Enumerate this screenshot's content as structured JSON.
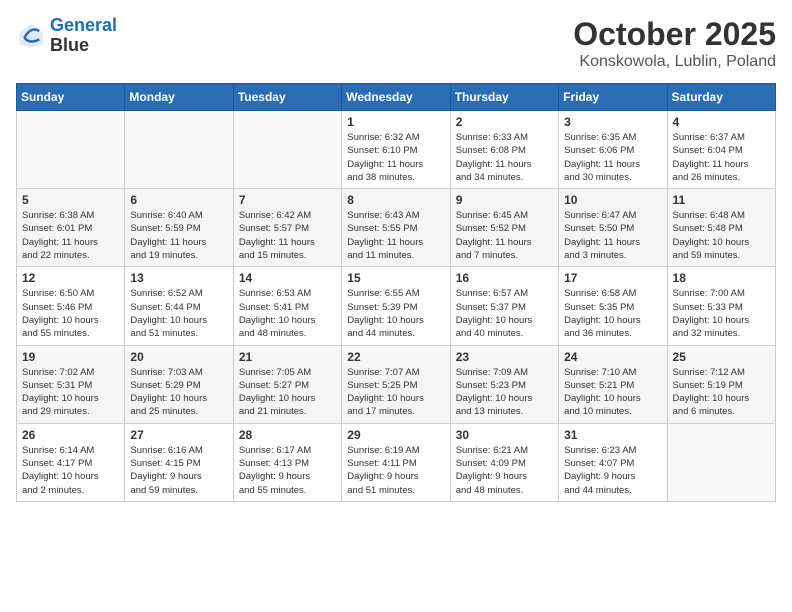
{
  "logo": {
    "line1": "General",
    "line2": "Blue"
  },
  "title": "October 2025",
  "location": "Konskowola, Lublin, Poland",
  "weekdays": [
    "Sunday",
    "Monday",
    "Tuesday",
    "Wednesday",
    "Thursday",
    "Friday",
    "Saturday"
  ],
  "weeks": [
    [
      {
        "day": "",
        "info": ""
      },
      {
        "day": "",
        "info": ""
      },
      {
        "day": "",
        "info": ""
      },
      {
        "day": "1",
        "info": "Sunrise: 6:32 AM\nSunset: 6:10 PM\nDaylight: 11 hours\nand 38 minutes."
      },
      {
        "day": "2",
        "info": "Sunrise: 6:33 AM\nSunset: 6:08 PM\nDaylight: 11 hours\nand 34 minutes."
      },
      {
        "day": "3",
        "info": "Sunrise: 6:35 AM\nSunset: 6:06 PM\nDaylight: 11 hours\nand 30 minutes."
      },
      {
        "day": "4",
        "info": "Sunrise: 6:37 AM\nSunset: 6:04 PM\nDaylight: 11 hours\nand 26 minutes."
      }
    ],
    [
      {
        "day": "5",
        "info": "Sunrise: 6:38 AM\nSunset: 6:01 PM\nDaylight: 11 hours\nand 22 minutes."
      },
      {
        "day": "6",
        "info": "Sunrise: 6:40 AM\nSunset: 5:59 PM\nDaylight: 11 hours\nand 19 minutes."
      },
      {
        "day": "7",
        "info": "Sunrise: 6:42 AM\nSunset: 5:57 PM\nDaylight: 11 hours\nand 15 minutes."
      },
      {
        "day": "8",
        "info": "Sunrise: 6:43 AM\nSunset: 5:55 PM\nDaylight: 11 hours\nand 11 minutes."
      },
      {
        "day": "9",
        "info": "Sunrise: 6:45 AM\nSunset: 5:52 PM\nDaylight: 11 hours\nand 7 minutes."
      },
      {
        "day": "10",
        "info": "Sunrise: 6:47 AM\nSunset: 5:50 PM\nDaylight: 11 hours\nand 3 minutes."
      },
      {
        "day": "11",
        "info": "Sunrise: 6:48 AM\nSunset: 5:48 PM\nDaylight: 10 hours\nand 59 minutes."
      }
    ],
    [
      {
        "day": "12",
        "info": "Sunrise: 6:50 AM\nSunset: 5:46 PM\nDaylight: 10 hours\nand 55 minutes."
      },
      {
        "day": "13",
        "info": "Sunrise: 6:52 AM\nSunset: 5:44 PM\nDaylight: 10 hours\nand 51 minutes."
      },
      {
        "day": "14",
        "info": "Sunrise: 6:53 AM\nSunset: 5:41 PM\nDaylight: 10 hours\nand 48 minutes."
      },
      {
        "day": "15",
        "info": "Sunrise: 6:55 AM\nSunset: 5:39 PM\nDaylight: 10 hours\nand 44 minutes."
      },
      {
        "day": "16",
        "info": "Sunrise: 6:57 AM\nSunset: 5:37 PM\nDaylight: 10 hours\nand 40 minutes."
      },
      {
        "day": "17",
        "info": "Sunrise: 6:58 AM\nSunset: 5:35 PM\nDaylight: 10 hours\nand 36 minutes."
      },
      {
        "day": "18",
        "info": "Sunrise: 7:00 AM\nSunset: 5:33 PM\nDaylight: 10 hours\nand 32 minutes."
      }
    ],
    [
      {
        "day": "19",
        "info": "Sunrise: 7:02 AM\nSunset: 5:31 PM\nDaylight: 10 hours\nand 29 minutes."
      },
      {
        "day": "20",
        "info": "Sunrise: 7:03 AM\nSunset: 5:29 PM\nDaylight: 10 hours\nand 25 minutes."
      },
      {
        "day": "21",
        "info": "Sunrise: 7:05 AM\nSunset: 5:27 PM\nDaylight: 10 hours\nand 21 minutes."
      },
      {
        "day": "22",
        "info": "Sunrise: 7:07 AM\nSunset: 5:25 PM\nDaylight: 10 hours\nand 17 minutes."
      },
      {
        "day": "23",
        "info": "Sunrise: 7:09 AM\nSunset: 5:23 PM\nDaylight: 10 hours\nand 13 minutes."
      },
      {
        "day": "24",
        "info": "Sunrise: 7:10 AM\nSunset: 5:21 PM\nDaylight: 10 hours\nand 10 minutes."
      },
      {
        "day": "25",
        "info": "Sunrise: 7:12 AM\nSunset: 5:19 PM\nDaylight: 10 hours\nand 6 minutes."
      }
    ],
    [
      {
        "day": "26",
        "info": "Sunrise: 6:14 AM\nSunset: 4:17 PM\nDaylight: 10 hours\nand 2 minutes."
      },
      {
        "day": "27",
        "info": "Sunrise: 6:16 AM\nSunset: 4:15 PM\nDaylight: 9 hours\nand 59 minutes."
      },
      {
        "day": "28",
        "info": "Sunrise: 6:17 AM\nSunset: 4:13 PM\nDaylight: 9 hours\nand 55 minutes."
      },
      {
        "day": "29",
        "info": "Sunrise: 6:19 AM\nSunset: 4:11 PM\nDaylight: 9 hours\nand 51 minutes."
      },
      {
        "day": "30",
        "info": "Sunrise: 6:21 AM\nSunset: 4:09 PM\nDaylight: 9 hours\nand 48 minutes."
      },
      {
        "day": "31",
        "info": "Sunrise: 6:23 AM\nSunset: 4:07 PM\nDaylight: 9 hours\nand 44 minutes."
      },
      {
        "day": "",
        "info": ""
      }
    ]
  ]
}
